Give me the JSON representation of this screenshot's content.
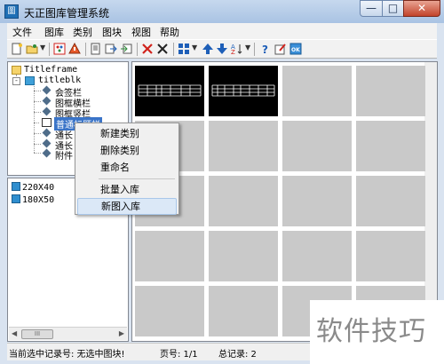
{
  "window": {
    "title": "天正图库管理系统",
    "app_icon_glyph": "圖",
    "controls": {
      "minimize": "—",
      "maximize": "□",
      "close": "✕"
    }
  },
  "menubar": [
    "文件",
    "图库",
    "类别",
    "图块",
    "视图",
    "帮助"
  ],
  "toolbar": {
    "icons": [
      "new-lib-icon",
      "open-lib-icon",
      "palette-icon",
      "alert-icon",
      "copy-icon",
      "export-icon",
      "import-icon",
      "delete-icon",
      "cross-icon",
      "view-mode-icon",
      "arrow-up-icon",
      "arrow-down-icon",
      "sort-icon",
      "help-icon",
      "edit-icon",
      "ok-icon"
    ],
    "colors": {
      "red": "#d0221c",
      "blue": "#1e5fb8",
      "green": "#2f8c3b"
    }
  },
  "tree": {
    "root": "Titleframe",
    "group": "titleblk",
    "children": [
      "会签栏",
      "图框横栏",
      "图框竖栏",
      "普通标题栏",
      "通长标题栏",
      "通长角栏",
      "附件"
    ],
    "selected_index": 3,
    "visible_labels": [
      "会签栏",
      "图框横栏",
      "图框竖栏",
      "普通标题栏",
      "通长",
      "通长",
      "附件"
    ]
  },
  "list": {
    "items": [
      "220X40",
      "180X50"
    ],
    "scroll_thumb": "III"
  },
  "grid": {
    "rows": 5,
    "cols": 4,
    "thumbnail_cells": [
      0,
      1
    ],
    "cell_color": "#c9c9c9"
  },
  "context_menu": {
    "items": [
      {
        "label": "新建类别",
        "separator_after": false
      },
      {
        "label": "删除类别",
        "separator_after": false
      },
      {
        "label": "重命名",
        "separator_after": true
      },
      {
        "label": "批量入库",
        "separator_after": false
      },
      {
        "label": "新图入库",
        "separator_after": false,
        "highlighted": true
      }
    ]
  },
  "statusbar": {
    "record": "当前选中记录号: 无选中图块!",
    "page": "页号: 1/1",
    "total": "总记录: 2"
  },
  "watermark": "软件技巧"
}
